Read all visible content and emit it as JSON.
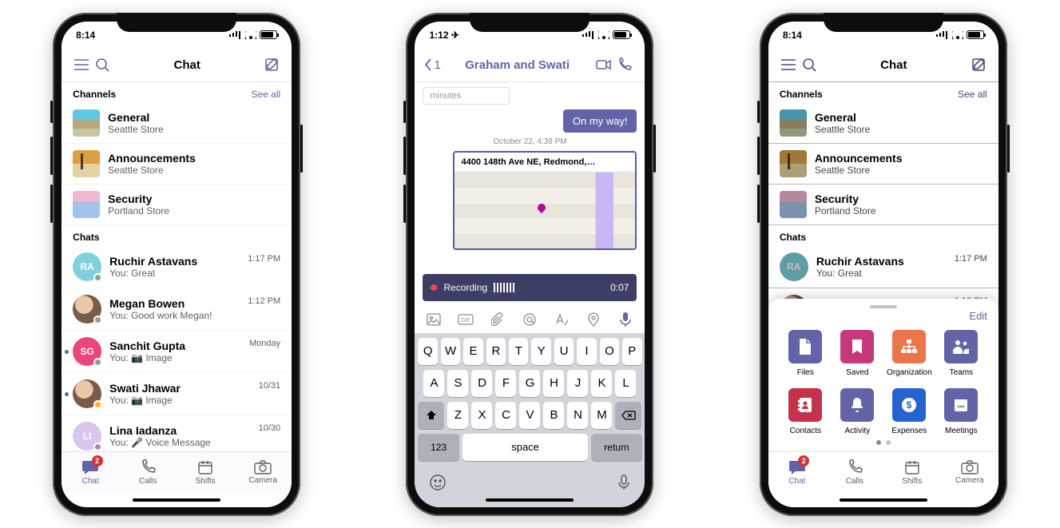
{
  "phone1": {
    "status": {
      "time": "8:14"
    },
    "nav": {
      "title": "Chat"
    },
    "sections": {
      "channels": {
        "header": "Channels",
        "see_all": "See all",
        "items": [
          {
            "name": "General",
            "sub": "Seattle Store",
            "iconClass": "ci-general"
          },
          {
            "name": "Announcements",
            "sub": "Seattle Store",
            "iconClass": "ci-annc"
          },
          {
            "name": "Security",
            "sub": "Portland Store",
            "iconClass": "ci-sec"
          }
        ]
      },
      "chats": {
        "header": "Chats",
        "items": [
          {
            "name": "Ruchir Astavans",
            "sub": "You: Great",
            "time": "1:17 PM",
            "initials": "RA",
            "bg": "#7fd1e0",
            "presence": "offline",
            "unread": false
          },
          {
            "name": "Megan Bowen",
            "sub": "You: Good work Megan!",
            "time": "1:12 PM",
            "initials": "",
            "bg": "url",
            "presence": "offline",
            "unread": false,
            "photo": true
          },
          {
            "name": "Sanchit Gupta",
            "sub": "You: 📷 Image",
            "time": "Monday",
            "initials": "SG",
            "bg": "#e8467c",
            "presence": "offline",
            "unread": true
          },
          {
            "name": "Swati Jhawar",
            "sub": "You: 📷 Image",
            "time": "10/31",
            "initials": "",
            "bg": "url",
            "presence": "away",
            "unread": true,
            "photo": true
          },
          {
            "name": "Lina Iadanza",
            "sub": "You: 🎤 Voice Message",
            "time": "10/30",
            "initials": "LI",
            "bg": "#d9c5ee",
            "presence": "offline",
            "unread": false
          }
        ]
      }
    },
    "tabs": [
      {
        "label": "Chat",
        "active": true,
        "badge": "2"
      },
      {
        "label": "Calls"
      },
      {
        "label": "Shifts"
      },
      {
        "label": "Camera"
      }
    ]
  },
  "phone2": {
    "status": {
      "time": "1:12 ✈"
    },
    "back_count": "1",
    "title": "Graham and Swati",
    "stub": "minutes",
    "bubble": "On my way!",
    "timestamp": "October 22, 4:39 PM",
    "address": "4400 148th Ave NE,  Redmond,…",
    "recording": {
      "label": "Recording",
      "time": "0:07"
    },
    "keyboard": {
      "r1": [
        "Q",
        "W",
        "E",
        "R",
        "T",
        "Y",
        "U",
        "I",
        "O",
        "P"
      ],
      "r2": [
        "A",
        "S",
        "D",
        "F",
        "G",
        "H",
        "J",
        "K",
        "L"
      ],
      "r3": [
        "Z",
        "X",
        "C",
        "V",
        "B",
        "N",
        "M"
      ],
      "num": "123",
      "space": "space",
      "ret": "return"
    }
  },
  "phone3": {
    "status": {
      "time": "8:14"
    },
    "nav": {
      "title": "Chat"
    },
    "edit": "Edit",
    "apps": [
      {
        "label": "Files",
        "bg": "#6264a7",
        "icon": "file"
      },
      {
        "label": "Saved",
        "bg": "#c7397b",
        "icon": "bookmark"
      },
      {
        "label": "Organization",
        "bg": "#e97548",
        "icon": "org"
      },
      {
        "label": "Teams",
        "bg": "#6264a7",
        "icon": "teams"
      },
      {
        "label": "Contacts",
        "bg": "#c4314b",
        "icon": "contacts"
      },
      {
        "label": "Activity",
        "bg": "#6264a7",
        "icon": "bell"
      },
      {
        "label": "Expenses",
        "bg": "#2564cf",
        "icon": "dollar"
      },
      {
        "label": "Meetings",
        "bg": "#6264a7",
        "icon": "calendar"
      }
    ],
    "tabs": [
      {
        "label": "Chat",
        "active": true,
        "badge": "2"
      },
      {
        "label": "Calls"
      },
      {
        "label": "Shifts"
      },
      {
        "label": "Camera"
      }
    ]
  }
}
